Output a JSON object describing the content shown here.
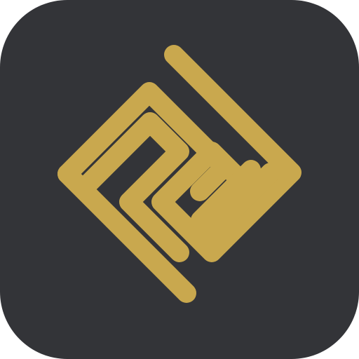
{
  "app_icon": {
    "name": "maze-logo-icon",
    "colors": {
      "tile_background": "#333438",
      "page_background": "#ffffff",
      "mark": "#C9A84E"
    }
  }
}
